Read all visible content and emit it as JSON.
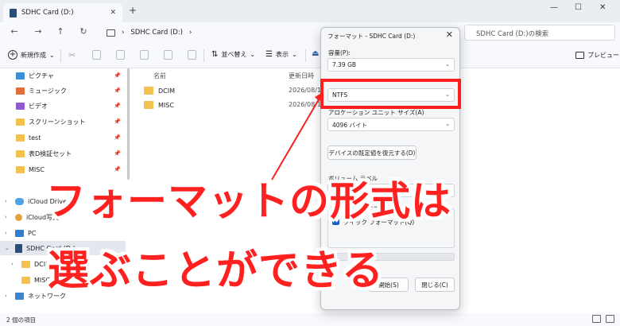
{
  "window": {
    "tab_title": "SDHC Card (D:)",
    "tab_close": "✕",
    "tab_add": "+",
    "min": "—",
    "max": "☐",
    "close": "✕"
  },
  "nav": {
    "back": "←",
    "forward": "→",
    "up": "↑",
    "refresh": "↻",
    "path_sep": "›",
    "path": "SDHC Card (D:)",
    "path_more": "›",
    "search_placeholder": "SDHC Card (D:)の検索"
  },
  "toolbar": {
    "new_label": "新規作成",
    "sort_label": "並べ替え",
    "view_label": "表示",
    "preview_label": "プレビュー",
    "chev": "⌄"
  },
  "sidebar": {
    "items": [
      {
        "label": "ピクチャ",
        "pin": "📌"
      },
      {
        "label": "ミュージック",
        "pin": "📌"
      },
      {
        "label": "ビデオ",
        "pin": "📌"
      },
      {
        "label": "スクリーンショット",
        "pin": "📌"
      },
      {
        "label": "test",
        "pin": "📌"
      },
      {
        "label": "表D検証セット",
        "pin": "📌"
      },
      {
        "label": "MISC",
        "pin": "📌"
      },
      {
        "label": "iCloud Drive"
      },
      {
        "label": "iCloud写真"
      },
      {
        "label": "PC"
      },
      {
        "label": "SDHC Card (D:)"
      },
      {
        "label": "DCIM"
      },
      {
        "label": "MISC"
      },
      {
        "label": "ネットワーク"
      }
    ],
    "expand": "›",
    "collapse": "⌄"
  },
  "list": {
    "col_name": "名前",
    "col_date": "更新日時",
    "files": [
      {
        "name": "DCIM",
        "date": "2026/08/11"
      },
      {
        "name": "MISC",
        "date": "2026/08/11"
      }
    ]
  },
  "status": {
    "count": "2 個の項目"
  },
  "dialog": {
    "title": "フォーマット - SDHC Card (D:)",
    "close": "✕",
    "capacity_label": "容量(P):",
    "capacity_value": "7.39 GB",
    "filesystem_value": "NTFS",
    "alloc_label": "アロケーション ユニット サイズ(A)",
    "alloc_value": "4096 バイト",
    "restore_button": "デバイスの既定値を復元する(D)",
    "volume_label": "ボリューム ラベル",
    "options_label": "フォーマット オプション",
    "quick_format": "クイック フォーマット(Q)",
    "start_button": "開始(S)",
    "close_button": "閉じる(C)",
    "arrow": "⌄"
  },
  "annotation": {
    "line1": "フォーマットの形式は",
    "line2": "選ぶことができる",
    "color": "#ff1f1f"
  }
}
